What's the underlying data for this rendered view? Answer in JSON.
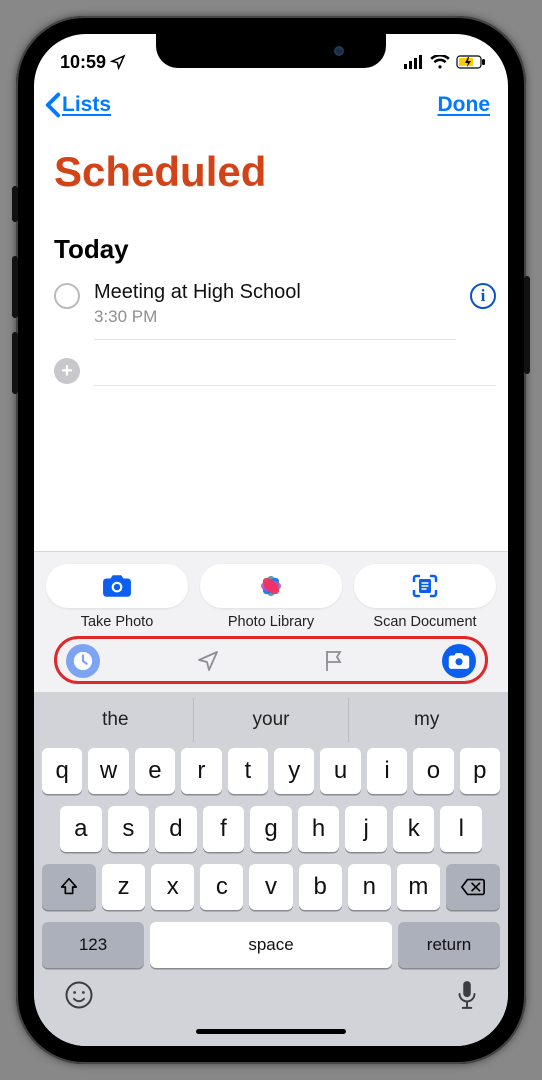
{
  "status": {
    "time": "10:59"
  },
  "nav": {
    "back_label": "Lists",
    "done_label": "Done"
  },
  "page_title": "Scheduled",
  "section": {
    "heading": "Today"
  },
  "reminders": [
    {
      "title": "Meeting at High School",
      "time": "3:30 PM"
    }
  ],
  "attachments": {
    "take_photo": "Take Photo",
    "photo_library": "Photo Library",
    "scan_document": "Scan Document"
  },
  "suggestions": [
    "the",
    "your",
    "my"
  ],
  "keyboard": {
    "row1": [
      "q",
      "w",
      "e",
      "r",
      "t",
      "y",
      "u",
      "i",
      "o",
      "p"
    ],
    "row2": [
      "a",
      "s",
      "d",
      "f",
      "g",
      "h",
      "j",
      "k",
      "l"
    ],
    "row3": [
      "z",
      "x",
      "c",
      "v",
      "b",
      "n",
      "m"
    ],
    "num_key": "123",
    "space_key": "space",
    "return_key": "return"
  }
}
